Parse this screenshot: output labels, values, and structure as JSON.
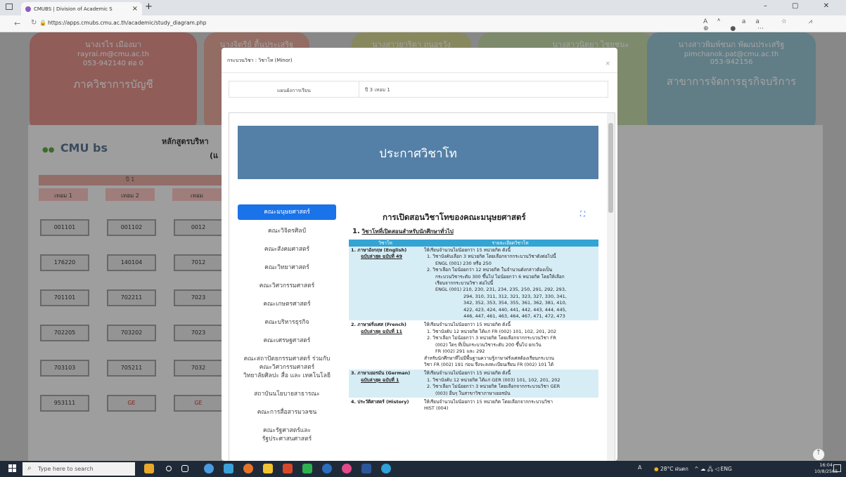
{
  "browser": {
    "tab_title": "CMUBS | Division of Academic S",
    "url": "https://apps.cmubs.cmu.ac.th/academic/study_diagram.php",
    "zoom_indicator": "Á"
  },
  "background": {
    "contacts": [
      {
        "name": "นางเรไร เมืองมา",
        "email": "rayrai.m@cmu.ac.th",
        "phone": "053-942140 ต่อ 0",
        "dept": "ภาควิชาการบัญชี",
        "color": "#d58a84"
      },
      {
        "name": "นางจิตรีย์ ตื้นประเสริฐ",
        "email": "",
        "phone": "",
        "dept": "",
        "color": "#d9a093"
      },
      {
        "name": "นางสาวยาริตา ถนอรวัง",
        "email": "",
        "phone": "",
        "dept": "",
        "color": "#c9c98c"
      },
      {
        "name": "นางสาวนิตยา ไชยชนะ",
        "email": "",
        "phone": "",
        "dept": "",
        "color": "#b9cc9e"
      },
      {
        "name": "นางสาวพิมพ์ชนก พัฒนประเสริฐ",
        "email": "pimchanok.pat@cmu.ac.th",
        "phone": "053-942156",
        "dept": "สาขาการจัดการธุรกิจบริการ",
        "color": "#8fb9c6"
      }
    ],
    "curriculum_title": "หลักสูตรบริหา",
    "curriculum_subtitle": "(แ",
    "year_label": "ปี 1",
    "terms": [
      "เทอม 1",
      "เทอม 2",
      "เทอม"
    ],
    "logo_text": "CMU bs",
    "courses": [
      [
        "001101",
        "001102",
        "0012"
      ],
      [
        "176220",
        "140104",
        "7012"
      ],
      [
        "701101",
        "702211",
        "7023"
      ],
      [
        "702205",
        "703202",
        "7023"
      ],
      [
        "703103",
        "705211",
        "7032"
      ],
      [
        "953111",
        "GE",
        "GE"
      ]
    ]
  },
  "modal": {
    "title": "กระบวนวิชา : วิชาโท (Minor)",
    "close_label": "×",
    "info_key": "แผนผังการเรียน",
    "info_value": "ปี 3 เทอม 1",
    "banner": "ประกาศวิชาโท",
    "faculties": [
      "คณะมนุษยศาสตร์",
      "คณะวิจิตรศิลป์",
      "คณะสังคมศาสตร์",
      "คณะวิทยาศาสตร์",
      "คณะวิศวกรรมศาสตร์",
      "คณะเกษตรศาสตร์",
      "คณะบริหารธุรกิจ",
      "คณะเศรษฐศาสตร์",
      "คณะสถาปัตยกรรมศาสตร์ ร่วมกับ",
      "คณะวิศวกรรมศาสตร์",
      "วิทยาลัยศิลปะ สื่อ และ เทคโนโลยี",
      "สถาบันนโยบายสาธารณะ",
      "คณะการสื่อสารมวลชน",
      "คณะรัฐศาสตร์และ รัฐประศาสนศาสตร์"
    ],
    "content_title": "การเปิดสอนวิชาโทของคณะมนุษยศาสตร์",
    "section_no": "1.",
    "section_title": "วิชาโทที่เปิดสอนสำหรับนักศึกษาทั่วไป",
    "table_headers": [
      "วิชาโท",
      "รายละเอียดวิชาโท"
    ],
    "table_rows": [
      {
        "subject": "1. ภาษาอังกฤษ (English)",
        "edition": "ฉบับล่าสุด ฉบับที่ 49",
        "lines": [
          "ให้เรียนจำนวนไม่น้อยกว่า 15 หน่วยกิต ดังนี้",
          "1. วิชาบังคับเลือก 3 หน่วยกิต โดยเลือกจากกระบวนวิชาดังต่อไปนี้",
          "ENGL (001) 230 หรือ 250",
          "2. วิชาเลือก ไม่น้อยกว่า 12 หน่วยกิต ในจำนวนดังกล่าวต้องเป็น",
          "กระบวนวิชาระดับ 300 ขึ้นไป ไม่น้อยกว่า 6 หน่วยกิต โดยให้เลือก",
          "เรียนจากกระบวนวิชา ต่อไปนี้",
          "ENGL (001) 210, 230, 231, 234, 235, 250, 291, 292, 293,",
          "294, 310, 311, 312, 321, 323, 327, 330, 341,",
          "342, 352, 353, 354, 355, 361, 362, 381, 410,",
          "422, 423, 424, 440, 441, 442, 443, 444, 445,",
          "446, 447, 461, 463, 464, 467, 471, 472, 473"
        ]
      },
      {
        "subject": "2. ภาษาฝรั่งเศส (French)",
        "edition": "ฉบับล่าสุด ฉบับที่ 11",
        "lines": [
          "ให้เรียนจำนวนไม่น้อยกว่า 15 หน่วยกิต ดังนี้",
          "1. วิชาบังคับ 12 หน่วยกิต ได้แก่ FR (002) 101, 102, 201, 202",
          "2. วิชาเลือก ไม่น้อยกว่า 3 หน่วยกิต โดยเลือกจากกระบวนวิชา FR",
          "(002) ใดๆ ที่เป็นกระบวนวิชาระดับ 200 ขึ้นไป ยกเว้น",
          "FR (002) 291 และ 292",
          "สำหรับนักศึกษาที่ไม่มีพื้นฐานความรู้ภาษาฝรั่งเศสต้องเรียนกระบวน",
          "วิชา FR (002) 191 ก่อน จึงจะลงทะเบียนเรียน FR (002) 101 ได้"
        ]
      },
      {
        "subject": "3. ภาษาเยอรมัน (German)",
        "edition": "ฉบับล่าสุด ฉบับที่ 1",
        "lines": [
          "ให้เรียนจำนวนไม่น้อยกว่า 15 หน่วยกิต ดังนี้",
          "1. วิชาบังคับ 12 หน่วยกิต ได้แก่ GER (003) 101, 102, 201, 202",
          "2. วิชาเลือก ไม่น้อยกว่า 3 หน่วยกิต โดยเลือกจากกระบวนวิชา GER",
          "(003) อื่นๆ ในสาขาวิชาภาษาเยอรมัน"
        ]
      },
      {
        "subject": "4. ประวัติศาสตร์ (History)",
        "edition": "",
        "lines": [
          "ให้เรียนจำนวนไม่น้อยกว่า 15 หน่วยกิต โดยเลือกจากกระบวนวิชา",
          "HIST (004)"
        ]
      }
    ]
  },
  "taskbar": {
    "search_placeholder": "Type here to search",
    "weather": "28°C ฝนตก",
    "time": "16:04",
    "date": "10/8/2565",
    "lang": "A"
  }
}
